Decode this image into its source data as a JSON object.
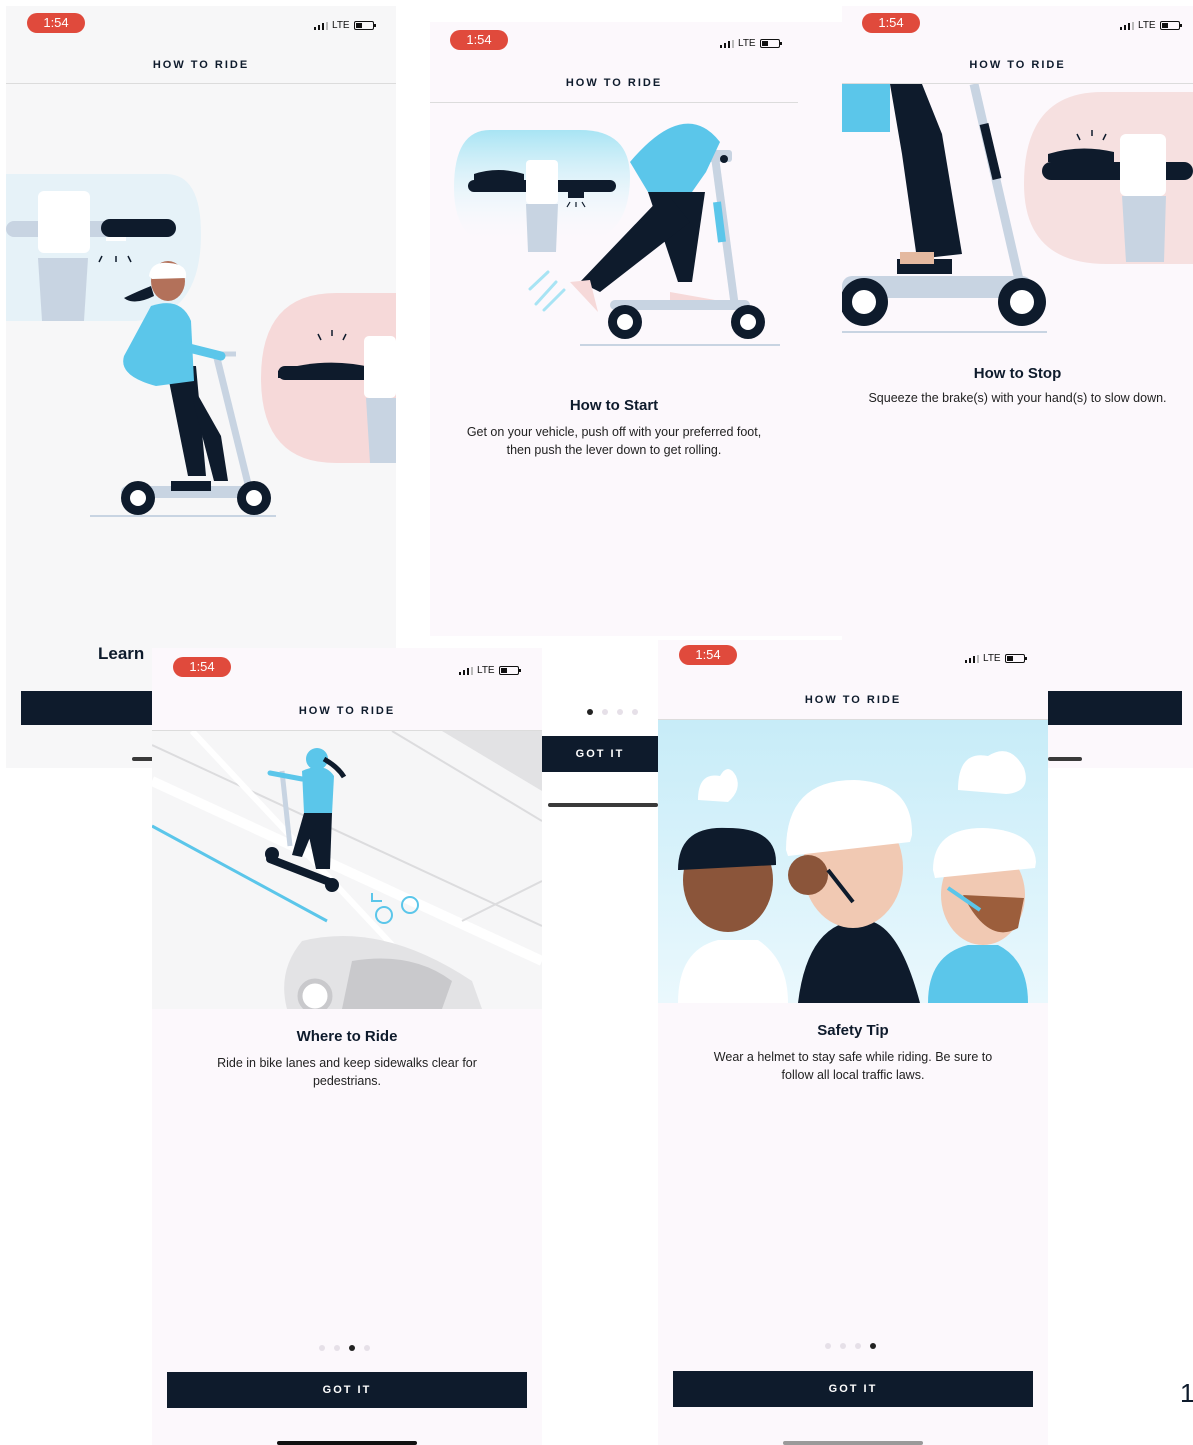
{
  "status": {
    "time": "1:54",
    "network": "LTE"
  },
  "screens": {
    "s1": {
      "header": "HOW TO RIDE",
      "title_partial": "Learn"
    },
    "s2": {
      "header": "HOW TO RIDE",
      "title": "How to Start",
      "desc_line1": "Get on your vehicle, push off with your preferred foot,",
      "desc_line2": "then push the lever down to get rolling."
    },
    "s3": {
      "header": "HOW TO RIDE",
      "title": "How to Stop",
      "desc": "Squeeze the brake(s) with your hand(s) to slow down."
    },
    "s4": {
      "header": "HOW TO RIDE",
      "title": "Where to Ride",
      "desc_line1": "Ride in bike lanes and keep sidewalks clear for",
      "desc_line2": "pedestrians.",
      "button": "GOT IT",
      "page_index": 3,
      "page_count": 4
    },
    "s5": {
      "header": "HOW TO RIDE",
      "title": "Safety Tip",
      "desc_line1": "Wear a helmet to stay safe while riding. Be sure to",
      "desc_line2": "follow all local traffic laws.",
      "button": "GOT IT",
      "page_index": 4,
      "page_count": 4
    },
    "behind": {
      "button": "GOT IT",
      "page_index": 1,
      "page_count": 4
    }
  },
  "page_number": "1",
  "colors": {
    "navy": "#0e1b2c",
    "sky": "#5bc6ea",
    "pink": "#f6d9d9",
    "time_pill": "#e04a3c"
  }
}
